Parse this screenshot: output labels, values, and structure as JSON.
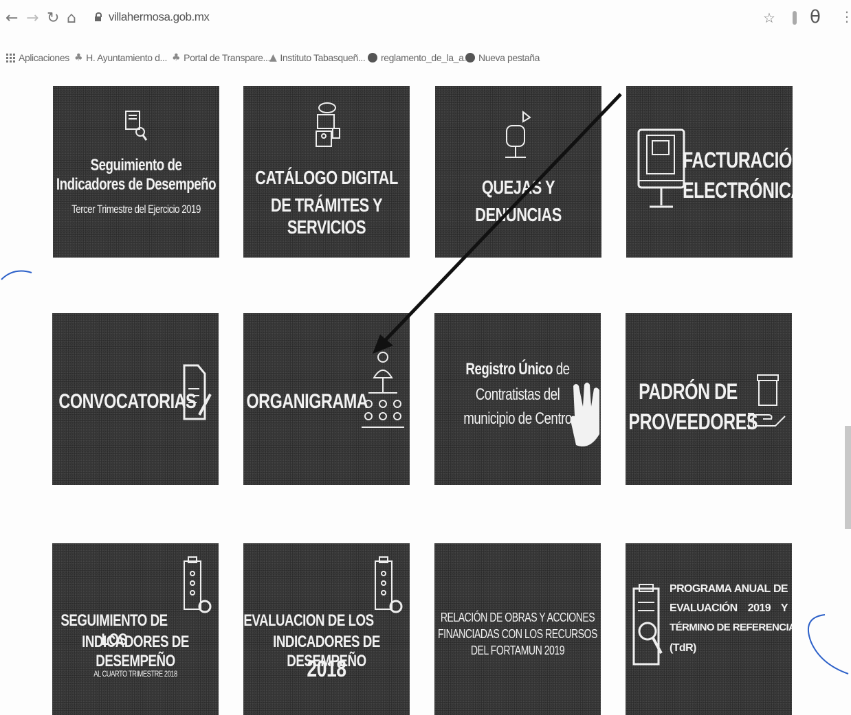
{
  "browser": {
    "url": "villahermosa.gob.mx",
    "bookmarks": [
      {
        "label": "Aplicaciones",
        "icon": "apps-icon"
      },
      {
        "label": "H. Ayuntamiento d...",
        "icon": "palm-icon"
      },
      {
        "label": "Portal de Transpare...",
        "icon": "palm-icon"
      },
      {
        "label": "Instituto Tabasqueñ...",
        "icon": "flame-icon"
      },
      {
        "label": "reglamento_de_la_a...",
        "icon": "globe-icon"
      },
      {
        "label": "Nueva pestaña",
        "icon": "globe-icon"
      }
    ]
  },
  "tiles": {
    "seguimiento_2019": {
      "line1": "Seguimiento de",
      "line2": "Indicadores de Desempeño",
      "line3": "Tercer Trimestre del Ejercicio 2019",
      "icon": "report-search-icon"
    },
    "catalogo": {
      "line1": "CATÁLOGO DIGITAL",
      "line2": "DE TRÁMITES Y SERVICIOS",
      "icon": "documents-icon"
    },
    "quejas": {
      "line1": "QUEJAS Y",
      "line2": "DENUNCIAS",
      "icon": "mailbox-icon"
    },
    "facturacion": {
      "line1": "FACTURACIÓN",
      "line2": "ELECTRÓNICA",
      "icon": "monitor-invoice-icon"
    },
    "convocatorias": {
      "label": "CONVOCATORIAS",
      "icon": "document-pencil-icon"
    },
    "organigrama": {
      "label": "ORGANIGRAMA",
      "icon": "org-chart-icon"
    },
    "registro": {
      "bold": "Registro Único",
      "rest": " de",
      "line2": "Contratistas del",
      "line3": "municipio de Centro",
      "icon": "hand-pointer-icon"
    },
    "padron": {
      "line1": "PADRÓN DE",
      "line2": "PROVEEDORES",
      "icon": "hand-box-icon"
    },
    "seguimiento_2018": {
      "line1": "SEGUIMIENTO DE LOS",
      "line2": "INDICADORES DE DESEMPEÑO",
      "line3": "AL CUARTO TRIMESTRE 2018",
      "icon": "checklist-gear-icon"
    },
    "evaluacion_2018": {
      "line1": "EVALUACION DE LOS",
      "line2": "INDICADORES DE DESEMPEÑO",
      "line3": "2018",
      "icon": "checklist-gear-icon"
    },
    "relacion_obras": {
      "line1": "RELACIÓN DE OBRAS Y ACCIONES",
      "line2": "FINANCIADAS CON LOS RECURSOS",
      "line3": "DEL FORTAMUN 2019"
    },
    "programa_anual": {
      "line1": "PROGRAMA ANUAL DE",
      "line2": "EVALUACIÓN 2019 Y",
      "line3": "TÉRMINO DE REFERENCIA",
      "line4": "(TdR)",
      "icon": "clipboard-magnifier-icon"
    }
  },
  "colors": {
    "tile_bg": "#3a3a3a",
    "tile_text": "#f2f2f2",
    "pen_ink": "#2a5fc8",
    "arrow": "#111111"
  }
}
